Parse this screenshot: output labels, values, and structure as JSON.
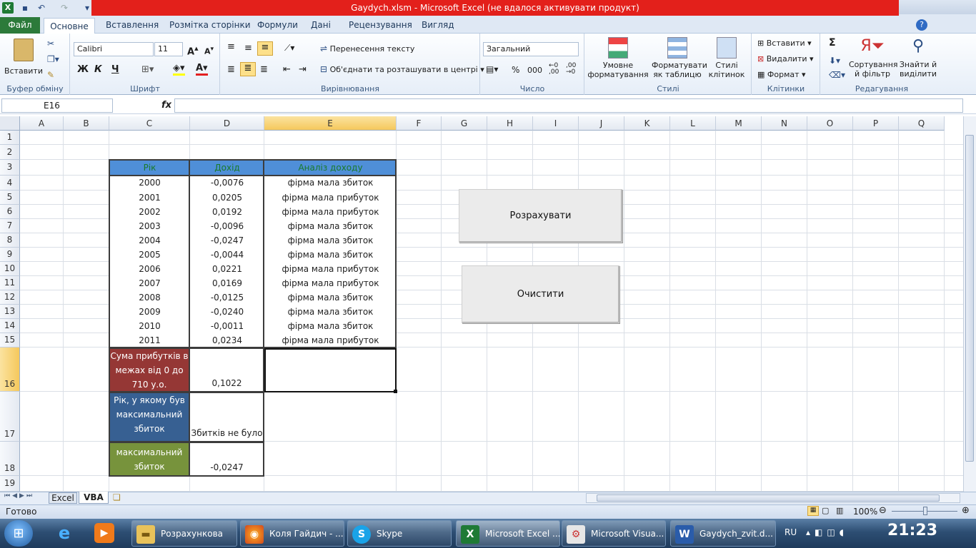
{
  "window": {
    "title": "Gaydych.xlsm  -  Microsoft Excel (не вдалося активувати продукт)"
  },
  "tabs": {
    "file": "Файл",
    "items": [
      "Основне",
      "Вставлення",
      "Розмітка сторінки",
      "Формули",
      "Дані",
      "Рецензування",
      "Вигляд"
    ]
  },
  "ribbon": {
    "clipboard": {
      "paste": "Вставити",
      "label": "Буфер обміну"
    },
    "font": {
      "name": "Calibri",
      "size": "11",
      "label": "Шрифт",
      "bold": "Ж",
      "italic": "К",
      "underline": "Ч"
    },
    "alignment": {
      "wrap": "Перенесення тексту",
      "merge": "Об'єднати та розташувати в центрі",
      "label": "Вирівнювання"
    },
    "number": {
      "format": "Загальний",
      "label": "Число",
      "percent": "%",
      "thousands": "000"
    },
    "styles": {
      "conditional_1": "Умовне",
      "conditional_2": "форматування",
      "table_1": "Форматувати",
      "table_2": "як таблицю",
      "cell_1": "Стилі",
      "cell_2": "клітинок",
      "label": "Стилі"
    },
    "cells": {
      "insert": "Вставити",
      "delete": "Видалити",
      "format": "Формат",
      "label": "Клітинки"
    },
    "editing": {
      "sort_1": "Сортування",
      "sort_2": "й фільтр",
      "find_1": "Знайти й",
      "find_2": "виділити",
      "label": "Редагування",
      "sigma": "Σ"
    }
  },
  "formula_bar": {
    "name_box": "E16",
    "fx": "fx",
    "content": ""
  },
  "columns": [
    "A",
    "B",
    "C",
    "D",
    "E",
    "F",
    "G",
    "H",
    "I",
    "J",
    "K",
    "L",
    "M",
    "N",
    "O",
    "P",
    "Q"
  ],
  "rows": [
    "1",
    "2",
    "3",
    "4",
    "5",
    "6",
    "7",
    "8",
    "9",
    "10",
    "11",
    "12",
    "13",
    "14",
    "15",
    "16",
    "17",
    "18",
    "19"
  ],
  "table": {
    "headers": [
      "Рік",
      "Дохід",
      "Аналіз доходу"
    ],
    "data": [
      [
        "2000",
        "-0,0076",
        "фірма мала збиток"
      ],
      [
        "2001",
        "0,0205",
        "фірма мала прибуток"
      ],
      [
        "2002",
        "0,0192",
        "фірма мала прибуток"
      ],
      [
        "2003",
        "-0,0096",
        "фірма мала збиток"
      ],
      [
        "2004",
        "-0,0247",
        "фірма мала збиток"
      ],
      [
        "2005",
        "-0,0044",
        "фірма мала збиток"
      ],
      [
        "2006",
        "0,0221",
        "фірма мала прибуток"
      ],
      [
        "2007",
        "0,0169",
        "фірма мала прибуток"
      ],
      [
        "2008",
        "-0,0125",
        "фірма мала збиток"
      ],
      [
        "2009",
        "-0,0240",
        "фірма мала збиток"
      ],
      [
        "2010",
        "-0,0011",
        "фірма мала збиток"
      ],
      [
        "2011",
        "0,0234",
        "фірма мала прибуток"
      ]
    ],
    "summary": [
      {
        "label": [
          "Сума прибутків в",
          "межах від 0 до",
          "710 у.о."
        ],
        "value": "0,1022",
        "color": "#953735"
      },
      {
        "label": [
          "Рік, у якому був",
          "максимальний",
          "збиток"
        ],
        "value": "Збитків не було",
        "color": "#376092"
      },
      {
        "label": [
          "максимальний",
          "збиток"
        ],
        "value": "-0,0247",
        "color": "#77933c"
      }
    ]
  },
  "buttons": {
    "calculate": "Розрахувати",
    "clear": "Очистити"
  },
  "sheets": {
    "tabs": [
      "Excel",
      "VBA"
    ],
    "active": "VBA"
  },
  "status": {
    "ready": "Готово",
    "zoom": "100%"
  },
  "taskbar": {
    "items": [
      {
        "label": "Розрахункова",
        "icon": "folder-icon"
      },
      {
        "label": "Коля Гайдич - ...",
        "icon": "firefox-icon"
      },
      {
        "label": "Skype",
        "icon": "skype-icon"
      },
      {
        "label": "Microsoft Excel ...",
        "icon": "excel-icon"
      },
      {
        "label": "Microsoft Visua...",
        "icon": "vba-icon"
      },
      {
        "label": "Gaydych_zvit.d...",
        "icon": "word-icon"
      }
    ],
    "lang": "RU",
    "clock": "21:23"
  }
}
